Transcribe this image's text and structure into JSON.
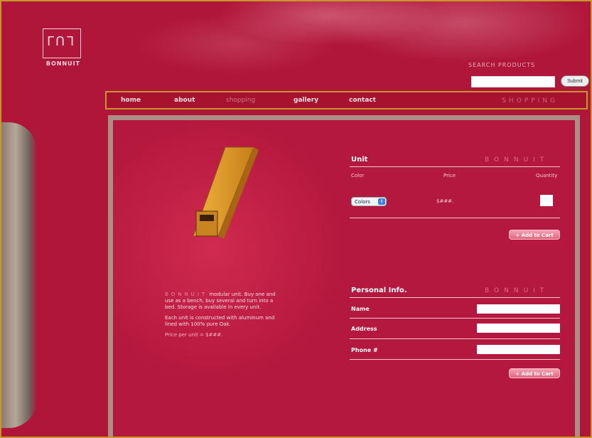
{
  "logo": {
    "glyph": "ᒥᑎᒣ",
    "name": "BONNUIT"
  },
  "search": {
    "label": "SEARCH PRODUCTS",
    "submit_label": "Submit",
    "value": ""
  },
  "nav": {
    "items": [
      {
        "label": "home"
      },
      {
        "label": "about"
      },
      {
        "label": "shopping"
      },
      {
        "label": "gallery"
      },
      {
        "label": "contact"
      }
    ],
    "section_label": "SHOPPING"
  },
  "product": {
    "description_brand": "BONNUIT",
    "description_1": "modular unit. Buy one and use as a bench, buy several and turn into a bed. Storage is available in every unit.",
    "description_2": "Each unit is constructed with aluminum and lined with 100% pure Oak.",
    "price_line": "Price per unit = $###."
  },
  "unit_form": {
    "title": "Unit",
    "brand": "BONNUIT",
    "col_color": "Color",
    "col_price": "Price",
    "col_quantity": "Quantity",
    "color_select": "Colors",
    "price_value": "$###.",
    "add_to_cart": "+ Add to Cart"
  },
  "personal_form": {
    "title": "Personal Info.",
    "brand": "BONNUIT",
    "name_label": "Name",
    "address_label": "Address",
    "phone_label": "Phone #",
    "add_to_cart": "+ Add to Cart"
  },
  "colors": {
    "background": "#b0163a",
    "frame_border": "#c9962c",
    "content_border": "#ab8e86"
  }
}
